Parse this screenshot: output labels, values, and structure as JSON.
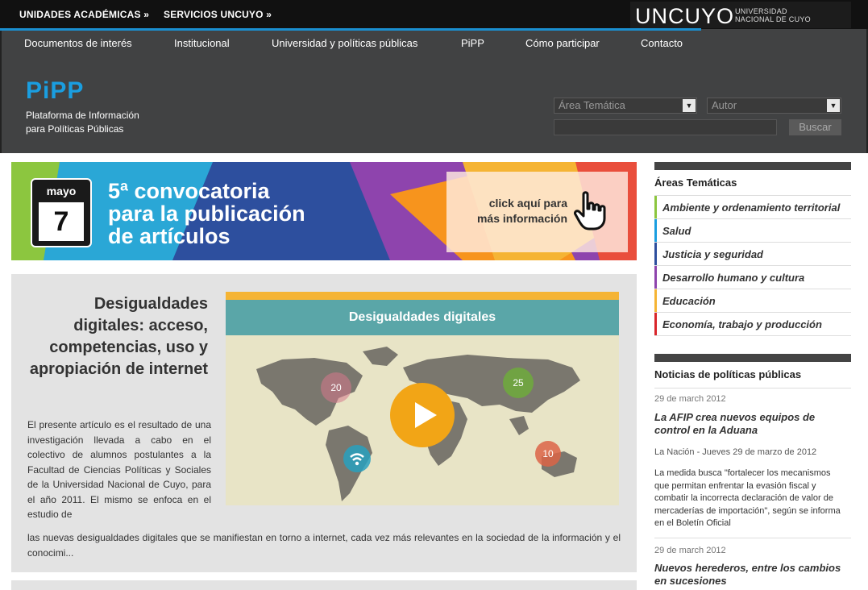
{
  "topbar": {
    "links": [
      "UNIDADES ACADÉMICAS »",
      "SERVICIOS UNCUYO »"
    ],
    "brand": "UNCUYO",
    "brand_sub_1": "UNIVERSIDAD",
    "brand_sub_2": "NACIONAL DE CUYO"
  },
  "nav": [
    "Documentos de interés",
    "Institucional",
    "Universidad y políticas públicas",
    "PiPP",
    "Cómo participar",
    "Contacto"
  ],
  "site": {
    "logo": "PiPP",
    "tagline_1": "Plataforma de Información",
    "tagline_2": "para Políticas Públicas"
  },
  "search": {
    "area_select": "Área Temática",
    "author_select": "Autor",
    "button": "Buscar"
  },
  "banner": {
    "month": "mayo",
    "day": "7",
    "title_1": "5ª convocatoria",
    "title_2": "para la publicación",
    "title_3": "de artículos",
    "click_1": "click aquí para",
    "click_2": "más información"
  },
  "article": {
    "title": "Desigualdades digitales: acceso, competencias, uso y apropiación de internet",
    "body_1": "El presente artículo es el resultado de una investigación llevada a cabo en el colectivo de alumnos postulantes a la Facultad de Ciencias Políticas y Sociales de la Universidad Nacional de Cuyo, para el año 2011. El mismo se enfoca en el estudio de",
    "body_2": "las nuevas desigualdades digitales que se manifiestan en torno a internet, cada vez más relevantes en la sociedad de la información y el conocimi...",
    "image_title": "Desigualdades digitales",
    "bubble_1": "20",
    "bubble_2": "25",
    "bubble_3": "10"
  },
  "sidebar": {
    "areas_heading": "Áreas Temáticas",
    "areas": [
      {
        "label": "Ambiente y ordenamiento territorial",
        "color": "#8cc63f"
      },
      {
        "label": "Salud",
        "color": "#1a9ee0"
      },
      {
        "label": "Justicia y seguridad",
        "color": "#2d4f9e"
      },
      {
        "label": "Desarrollo humano y cultura",
        "color": "#8e44ad"
      },
      {
        "label": "Educación",
        "color": "#f5b434"
      },
      {
        "label": "Economía, trabajo y producción",
        "color": "#d9262b"
      }
    ],
    "news_heading": "Noticias de políticas públicas",
    "news": [
      {
        "date": "29 de march 2012",
        "title": "La AFIP crea nuevos equipos de control en la Aduana",
        "source": "La Nación - Jueves 29 de marzo de 2012",
        "text": "La medida busca \"fortalecer los mecanismos que permitan enfrentar la evasión fiscal y combatir la incorrecta declaración de valor de mercaderías de importación\", según se informa en el Boletín Oficial"
      },
      {
        "date": "29 de march 2012",
        "title": "Nuevos herederos, entre los cambios en sucesiones"
      }
    ]
  }
}
